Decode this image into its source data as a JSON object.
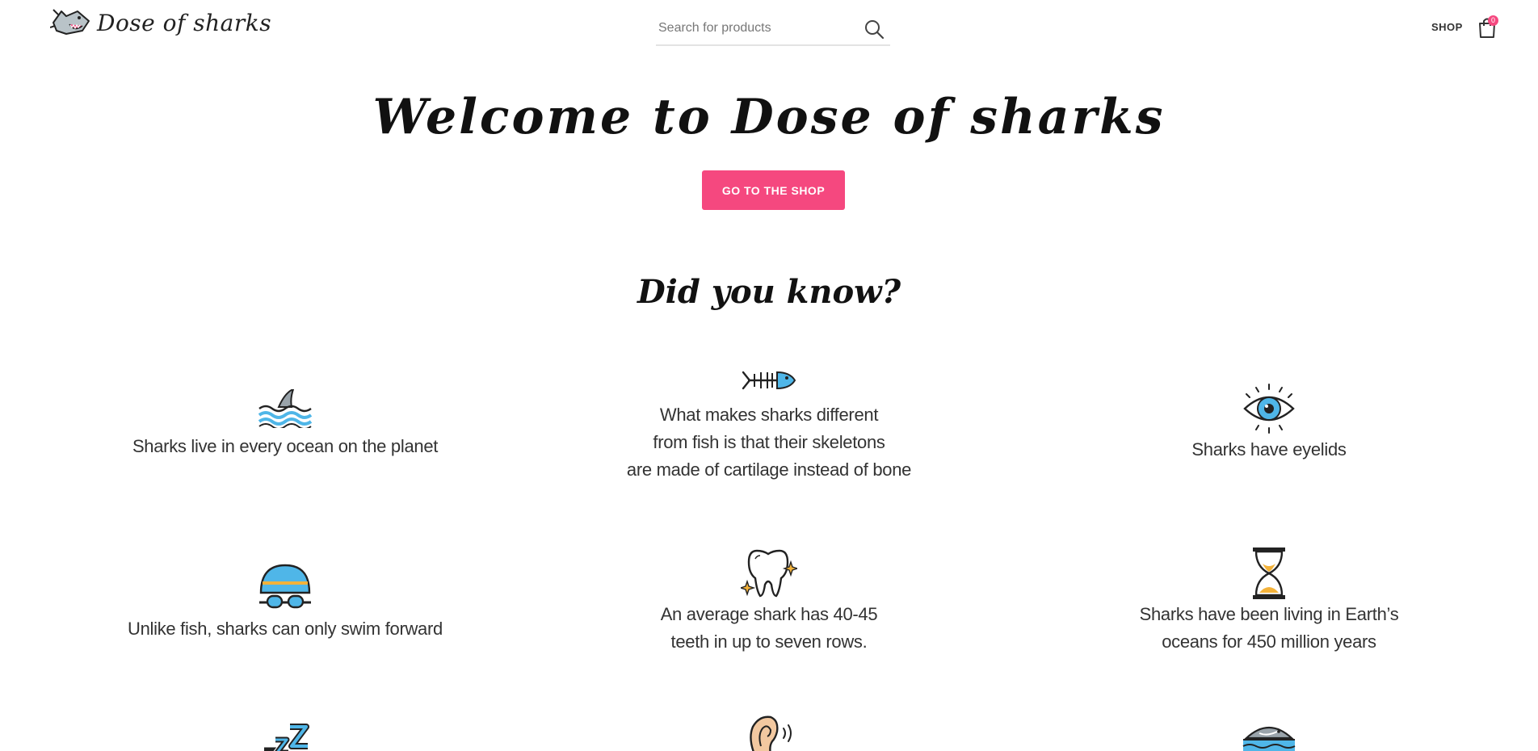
{
  "header": {
    "logo_text": "Dose of sharks",
    "search_placeholder": "Search for products",
    "nav": {
      "shop_label": "SHOP"
    },
    "cart_count": "0"
  },
  "hero": {
    "title": "Welcome to Dose of sharks",
    "cta_label": "GO TO THE SHOP"
  },
  "facts_section": {
    "title": "Did you know?",
    "facts": [
      {
        "icon": "shark-fin-waves-icon",
        "lines": [
          "Sharks live in every ocean on the planet"
        ]
      },
      {
        "icon": "fish-skeleton-icon",
        "lines": [
          "What makes sharks different",
          "from fish is that their skeletons",
          "are made of cartilage instead of bone"
        ]
      },
      {
        "icon": "eye-icon",
        "lines": [
          "Sharks have eyelids"
        ]
      },
      {
        "icon": "swim-cap-goggles-icon",
        "lines": [
          "Unlike fish, sharks can only swim forward"
        ]
      },
      {
        "icon": "tooth-icon",
        "lines": [
          "An average shark has 40-45",
          "teeth in up to seven rows."
        ]
      },
      {
        "icon": "hourglass-icon",
        "lines": [
          "Sharks have been living in Earth’s",
          "oceans for 450 million years"
        ]
      },
      {
        "icon": "sleep-zzz-icon",
        "lines": []
      },
      {
        "icon": "ear-icon",
        "lines": []
      },
      {
        "icon": "shark-in-water-icon",
        "lines": []
      }
    ]
  },
  "colors": {
    "accent": "#f5487f",
    "water_blue": "#4fb6e8",
    "text": "#333333"
  }
}
